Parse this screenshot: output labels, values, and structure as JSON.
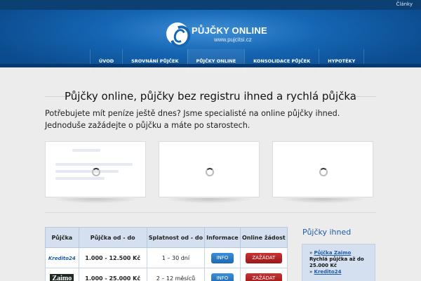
{
  "topbar": {
    "link_label": "Články"
  },
  "header": {
    "logo_title": "PŮJČKY ONLINE",
    "logo_subtitle": "www.pujcitsi.cz",
    "nav": [
      {
        "label": "ÚVOD"
      },
      {
        "label": "SROVNÁNÍ PŮJČEK"
      },
      {
        "label": "PŮJČKY ONLINE"
      },
      {
        "label": "KONSOLIDACE PŮJČEK"
      },
      {
        "label": "HYPOTÉKY"
      }
    ]
  },
  "main": {
    "title": "Půjčky online, půjčky bez registru ihned a rychlá půjčka",
    "intro": "Potřebujete mít peníze ještě dnes? Jsme specialisté na online půjčky ihned. Jednoduše zažádejte o půjčku a máte po starostech."
  },
  "table": {
    "headers": [
      "Půjčka",
      "Půjčka od - do",
      "Splatnost od - do",
      "Informace",
      "Online žádost"
    ],
    "rows": [
      {
        "brand": "Kredito24",
        "amount": "1.000 - 12.500 Kč",
        "term": "1 – 30 dní",
        "info_label": "INFO",
        "apply_label": "ZAŽÁDAT"
      },
      {
        "brand": "Zaimo",
        "amount": "1.000 - 25.000 Kč",
        "term": "2 – 12 měsíců",
        "info_label": "INFO",
        "apply_label": "ZAŽÁDAT"
      }
    ]
  },
  "sidebar": {
    "title": "Půjčky ihned",
    "items": [
      {
        "link": "Půjčka Zaimo",
        "text": "Rychlá půjčka až do 25.000 Kč"
      },
      {
        "link": "Kredito24",
        "text": ""
      }
    ]
  }
}
